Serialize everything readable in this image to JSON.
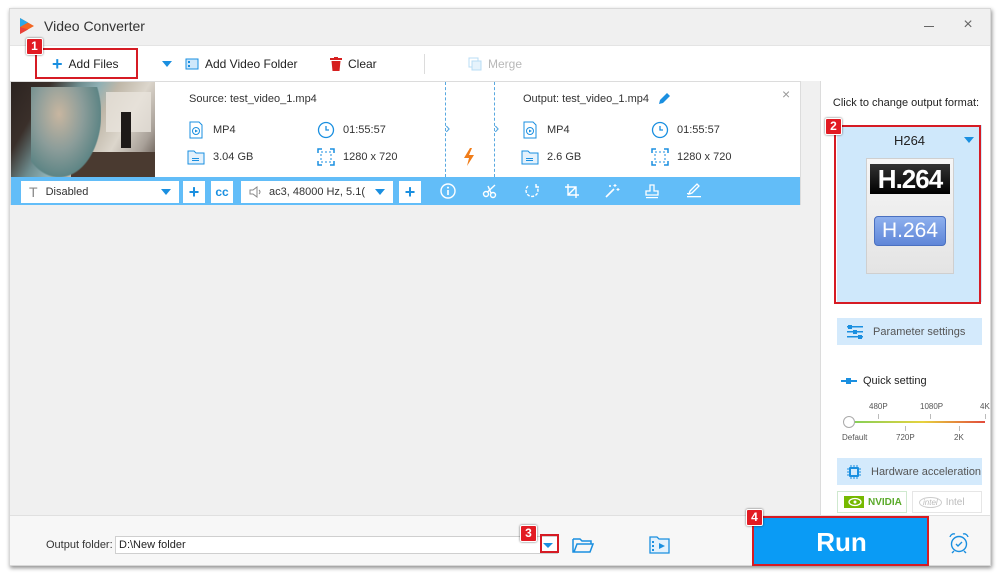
{
  "window": {
    "title": "Video Converter",
    "minimize_label": "—",
    "close_label": "×"
  },
  "toolbar": {
    "add_files": "Add Files",
    "add_video_folder": "Add Video Folder",
    "clear": "Clear",
    "merge": "Merge"
  },
  "callouts": {
    "step1": "1",
    "step2": "2",
    "step3": "3",
    "step4": "4"
  },
  "file": {
    "source_label": "Source: test_video_1.mp4",
    "output_label": "Output: test_video_1.mp4",
    "source": {
      "format": "MP4",
      "duration": "01:55:57",
      "size": "3.04 GB",
      "resolution": "1280 x 720"
    },
    "output": {
      "format": "MP4",
      "duration": "01:55:57",
      "size": "2.6 GB",
      "resolution": "1280 x 720"
    },
    "subtitle_select": "Disabled",
    "audio_select": "ac3, 48000 Hz, 5.1(",
    "close_label": "×"
  },
  "tools": [
    "info-icon",
    "scissors-icon",
    "rotate-icon",
    "crop-icon",
    "effects-icon",
    "watermark-icon",
    "edit-subtitle-icon"
  ],
  "panel": {
    "hint": "Click to change output format:",
    "format_name": "H264",
    "format_icon_top": "H.264",
    "format_icon_pill": "H.264",
    "parameter_settings": "Parameter settings",
    "quick_setting": "Quick setting",
    "slider_top_labels": [
      "480P",
      "1080P",
      "4K"
    ],
    "slider_bottom_labels": [
      "Default",
      "720P",
      "2K"
    ],
    "slider_value": "Default",
    "hardware_acceleration": "Hardware acceleration",
    "nvidia": "NVIDIA",
    "intel": "Intel",
    "intel_logo_text": "intel"
  },
  "bottom": {
    "output_folder_label": "Output folder:",
    "output_folder_value": "D:\\New folder",
    "run": "Run"
  },
  "colors": {
    "accent": "#1a8fe0",
    "run_button": "#0a9bf5",
    "callout_red": "#d61b24",
    "card_bar": "#62bdf8"
  }
}
